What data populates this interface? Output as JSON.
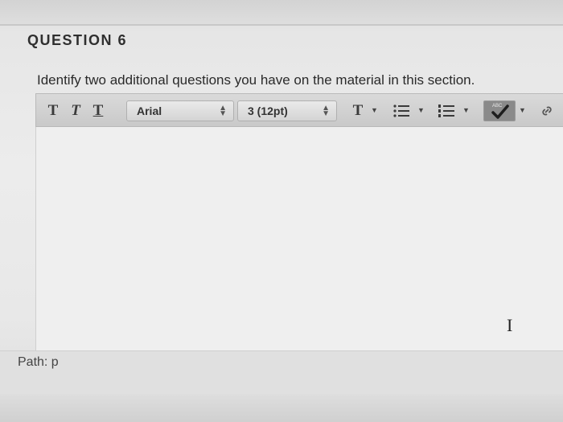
{
  "question": {
    "title": "QUESTION 6",
    "text": "Identify two additional questions you have on the material in this section."
  },
  "toolbar": {
    "bold_label": "T",
    "italic_label": "T",
    "underline_label": "T",
    "font_family": "Arial",
    "font_size": "3 (12pt)",
    "text_color_label": "T",
    "spellcheck_badge": "ABC"
  },
  "editor": {
    "content": ""
  },
  "path": {
    "label": "Path: p"
  }
}
